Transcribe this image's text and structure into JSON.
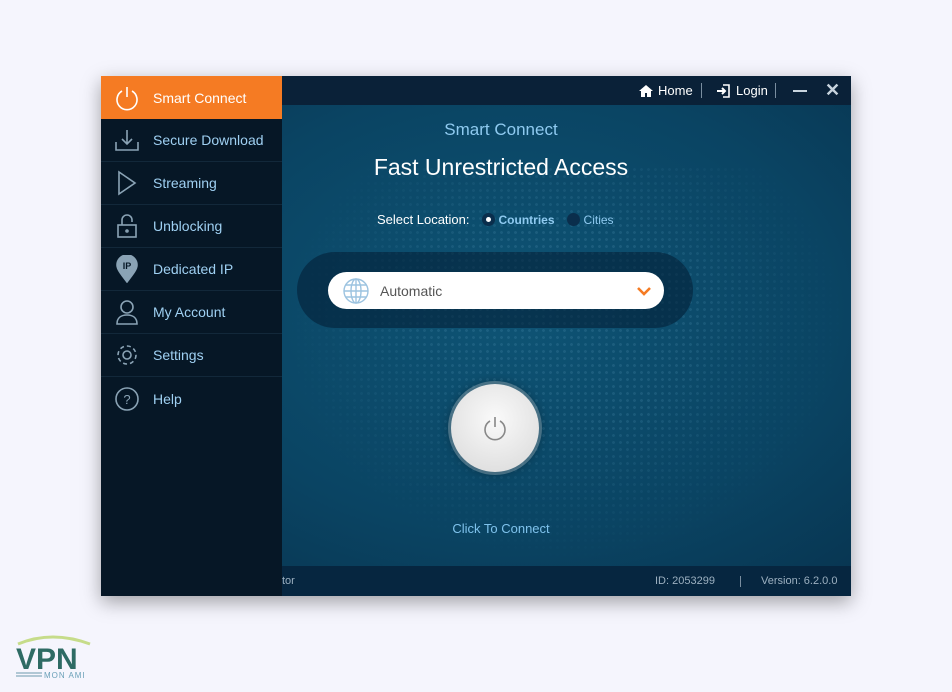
{
  "titlebar": {
    "home": "Home",
    "login": "Login"
  },
  "sidebar": {
    "items": [
      {
        "label": "Smart Connect",
        "icon": "power-icon",
        "active": true
      },
      {
        "label": "Secure Download",
        "icon": "download-icon"
      },
      {
        "label": "Streaming",
        "icon": "play-icon"
      },
      {
        "label": "Unblocking",
        "icon": "lock-icon"
      },
      {
        "label": "Dedicated IP",
        "icon": "ip-pin-icon"
      },
      {
        "label": "My Account",
        "icon": "user-icon"
      },
      {
        "label": "Settings",
        "icon": "gear-icon"
      },
      {
        "label": "Help",
        "icon": "help-icon"
      }
    ]
  },
  "main": {
    "subtitle": "Smart Connect",
    "title": "Fast Unrestricted Access",
    "select_location_label": "Select Location:",
    "options": [
      "Countries",
      "Cities"
    ],
    "selected_option": "Countries",
    "location_value": "Automatic",
    "connect_label": "Click To Connect"
  },
  "footer": {
    "left_fragment": "tor",
    "id": "ID:  2053299",
    "version": "Version:  6.2.0.0"
  },
  "watermark": {
    "brand": "VPN",
    "sub": "MON AMI"
  },
  "colors": {
    "accent": "#f57b23",
    "sidebar": "#061726",
    "link": "#8fcaf0"
  }
}
